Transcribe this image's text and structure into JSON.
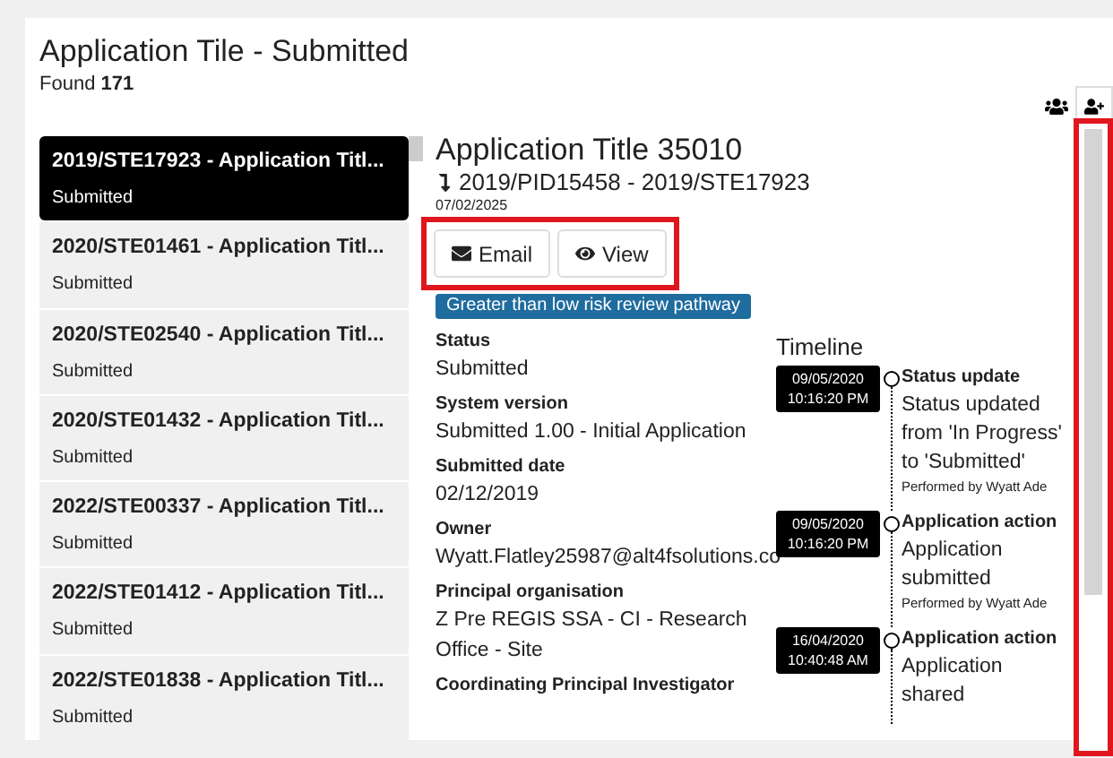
{
  "header": {
    "title": "Application Tile - Submitted",
    "found_label": "Found",
    "found_count": "171"
  },
  "applications": [
    {
      "title": "2019/STE17923 - Application Titl...",
      "status": "Submitted",
      "selected": true
    },
    {
      "title": "2020/STE01461 - Application Titl...",
      "status": "Submitted",
      "selected": false
    },
    {
      "title": "2020/STE02540 - Application Titl...",
      "status": "Submitted",
      "selected": false
    },
    {
      "title": "2020/STE01432 - Application Titl...",
      "status": "Submitted",
      "selected": false
    },
    {
      "title": "2022/STE00337 - Application Titl...",
      "status": "Submitted",
      "selected": false
    },
    {
      "title": "2022/STE01412 - Application Titl...",
      "status": "Submitted",
      "selected": false
    },
    {
      "title": "2022/STE01838 - Application Titl...",
      "status": "Submitted",
      "selected": false
    }
  ],
  "detail": {
    "title": "Application Title 35010",
    "reference": "2019/PID15458 - 2019/STE17923",
    "date": "07/02/2025",
    "buttons": [
      {
        "kind": "email",
        "label": "Email"
      },
      {
        "kind": "view",
        "label": "View"
      }
    ],
    "badge": "Greater than low risk review pathway",
    "fields": [
      {
        "label": "Status",
        "value": "Submitted"
      },
      {
        "label": "System version",
        "value": "Submitted 1.00 - Initial Application"
      },
      {
        "label": "Submitted date",
        "value": "02/12/2019"
      },
      {
        "label": "Owner",
        "value": "Wyatt.Flatley25987@alt4fsolutions.co"
      },
      {
        "label": "Principal organisation",
        "value": "Z Pre REGIS SSA - CI - Research Office - Site"
      },
      {
        "label": "Coordinating Principal Investigator"
      }
    ]
  },
  "timeline": {
    "title": "Timeline",
    "entries": [
      {
        "date": "09/05/2020",
        "time": "10:16:20 PM",
        "title": "Status update",
        "description": "Status updated from 'In Progress' to 'Submitted'",
        "performed_by": "Performed by Wyatt Ade"
      },
      {
        "date": "09/05/2020",
        "time": "10:16:20 PM",
        "title": "Application action",
        "description": "Application submitted",
        "performed_by": "Performed by Wyatt Ade"
      },
      {
        "date": "16/04/2020",
        "time": "10:40:48 AM",
        "title": "Application action",
        "description": "Application shared"
      }
    ]
  }
}
